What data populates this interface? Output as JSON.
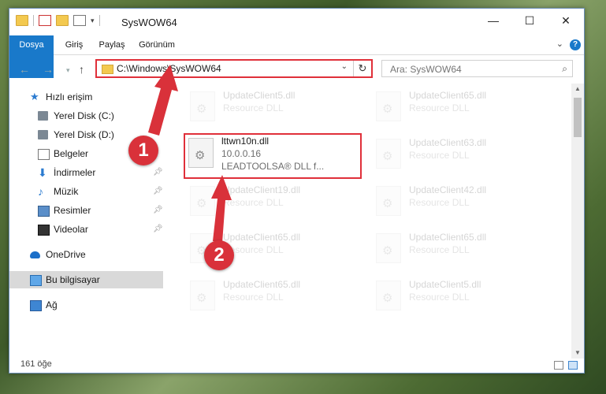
{
  "window": {
    "title": "SysWOW64"
  },
  "ribbon": {
    "tabs": [
      "Dosya",
      "Giriş",
      "Paylaş",
      "Görünüm"
    ]
  },
  "address": {
    "path": "C:\\Windows\\SysWOW64",
    "search_placeholder": "Ara: SysWOW64"
  },
  "sidebar": {
    "items": [
      {
        "label": "Hızlı erişim",
        "icon": "star-icon"
      },
      {
        "label": "Yerel Disk (C:)",
        "icon": "drive-icon"
      },
      {
        "label": "Yerel Disk (D:)",
        "icon": "drive-icon"
      },
      {
        "label": "Belgeler",
        "icon": "documents-icon"
      },
      {
        "label": "İndirmeler",
        "icon": "download-icon"
      },
      {
        "label": "Müzik",
        "icon": "music-icon"
      },
      {
        "label": "Resimler",
        "icon": "pictures-icon"
      },
      {
        "label": "Videolar",
        "icon": "video-icon"
      },
      {
        "label": "OneDrive",
        "icon": "cloud-icon"
      },
      {
        "label": "Bu bilgisayar",
        "icon": "computer-icon"
      },
      {
        "label": "Ağ",
        "icon": "network-icon"
      }
    ]
  },
  "files": {
    "highlighted": {
      "name": "lttwn10n.dll",
      "version": "10.0.0.16",
      "description": "LEADTOOLSA® DLL f..."
    },
    "background": [
      {
        "name": "UpdateClient5.dll",
        "type": "Resource DLL"
      },
      {
        "name": "UpdateClient65.dll",
        "type": "Resource DLL"
      },
      {
        "name": "UpdateClient63.dll",
        "type": "Resource DLL"
      },
      {
        "name": "UpdateClient19.dll",
        "type": "Resource DLL"
      },
      {
        "name": "UpdateClient42.dll",
        "type": "Resource DLL"
      },
      {
        "name": "UpdateClient65.dll",
        "type": "Resource DLL"
      },
      {
        "name": "UpdateClient65.dll",
        "type": "Resource DLL"
      },
      {
        "name": "UpdateClient65.dll",
        "type": "Resource DLL"
      },
      {
        "name": "UpdateClient5.dll",
        "type": "Resource DLL"
      }
    ]
  },
  "status": {
    "count": "161 öğe"
  },
  "annotations": {
    "step1": "1",
    "step2": "2",
    "color": "#d9313a"
  }
}
